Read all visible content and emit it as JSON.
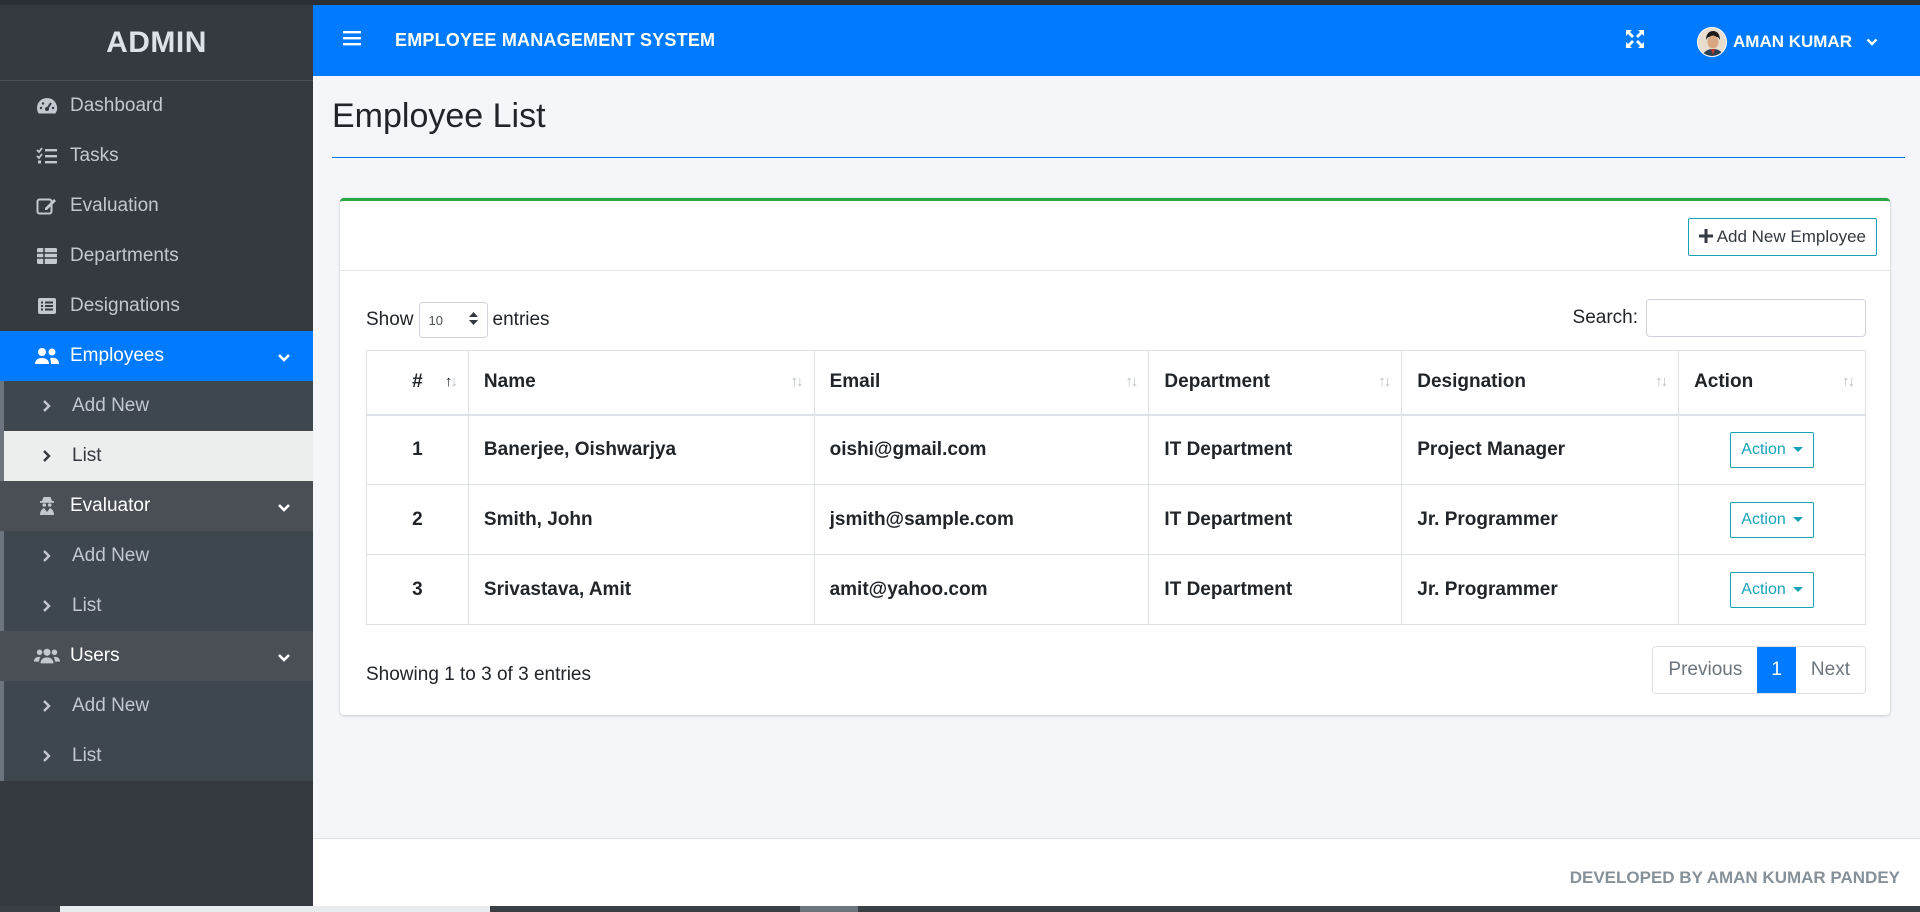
{
  "sidebar": {
    "brand": "ADMIN",
    "items": [
      {
        "label": "Dashboard",
        "icon": "tachometer-icon"
      },
      {
        "label": "Tasks",
        "icon": "tasks-icon"
      },
      {
        "label": "Evaluation",
        "icon": "edit-icon"
      },
      {
        "label": "Departments",
        "icon": "table-icon"
      },
      {
        "label": "Designations",
        "icon": "list-alt-icon"
      }
    ],
    "employees": {
      "label": "Employees",
      "icon": "users-icon",
      "sub": [
        "Add New",
        "List"
      ]
    },
    "evaluator": {
      "label": "Evaluator",
      "icon": "user-secret-icon",
      "sub": [
        "Add New",
        "List"
      ]
    },
    "users": {
      "label": "Users",
      "icon": "users-cog-icon",
      "sub": [
        "Add New",
        "List"
      ]
    }
  },
  "topbar": {
    "system_name": "EMPLOYEE MANAGEMENT SYSTEM",
    "user_name": "AMAN KUMAR"
  },
  "page": {
    "title": "Employee List",
    "add_button": "Add New Employee"
  },
  "table_controls": {
    "show_label": "Show",
    "page_length": "10",
    "entries_label": "entries",
    "search_label": "Search:",
    "search_value": ""
  },
  "table": {
    "headers": [
      "#",
      "Name",
      "Email",
      "Department",
      "Designation",
      "Action"
    ],
    "rows": [
      {
        "num": "1",
        "name": "Banerjee, Oishwarjya",
        "email": "oishi@gmail.com",
        "department": "IT Department",
        "designation": "Project Manager",
        "action": "Action"
      },
      {
        "num": "2",
        "name": "Smith, John",
        "email": "jsmith@sample.com",
        "department": "IT Department",
        "designation": "Jr. Programmer",
        "action": "Action"
      },
      {
        "num": "3",
        "name": "Srivastava, Amit",
        "email": "amit@yahoo.com",
        "department": "IT Department",
        "designation": "Jr. Programmer",
        "action": "Action"
      }
    ]
  },
  "pagination": {
    "info": "Showing 1 to 3 of 3 entries",
    "previous": "Previous",
    "current": "1",
    "next": "Next"
  },
  "footer": {
    "text": "DEVELOPED BY AMAN KUMAR PANDEY"
  },
  "colors": {
    "primary": "#007bff",
    "sidebar_bg": "#343a40",
    "card_accent": "#28a745",
    "info": "#17a2b8"
  }
}
